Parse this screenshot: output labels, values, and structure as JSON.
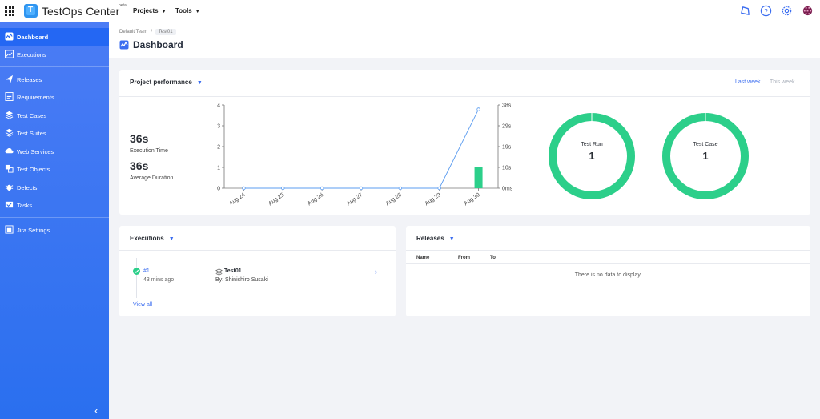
{
  "topbar": {
    "brand": "TestOps Center",
    "beta": "beta",
    "menus": [
      {
        "label": "Projects"
      },
      {
        "label": "Tools"
      }
    ],
    "icons": [
      "notification-icon",
      "help-icon",
      "settings-icon",
      "user-avatar-icon"
    ]
  },
  "sidebar": {
    "items": [
      {
        "label": "Dashboard",
        "icon": "dashboard-icon",
        "active": true
      },
      {
        "label": "Executions",
        "icon": "executions-icon"
      },
      {
        "label": "Releases",
        "icon": "releases-icon"
      },
      {
        "label": "Requirements",
        "icon": "requirements-icon"
      },
      {
        "label": "Test Cases",
        "icon": "test-cases-icon"
      },
      {
        "label": "Test Suites",
        "icon": "test-suites-icon"
      },
      {
        "label": "Web Services",
        "icon": "web-services-icon"
      },
      {
        "label": "Test Objects",
        "icon": "test-objects-icon"
      },
      {
        "label": "Defects",
        "icon": "defects-icon"
      },
      {
        "label": "Tasks",
        "icon": "tasks-icon"
      },
      {
        "label": "Jira Settings",
        "icon": "jira-icon"
      }
    ],
    "collapse_glyph": "‹"
  },
  "header": {
    "breadcrumb": [
      "Default Team",
      "Test01"
    ],
    "breadcrumb_sep": "/",
    "title": "Dashboard"
  },
  "performance": {
    "title": "Project performance",
    "tabs": {
      "last_week": "Last week",
      "this_week": "This week"
    },
    "execution_time": "36s",
    "execution_time_label": "Execution Time",
    "average_duration": "36s",
    "average_duration_label": "Average Duration",
    "donuts": [
      {
        "label": "Test Run",
        "value": "1",
        "fraction": 1.0
      },
      {
        "label": "Test Case",
        "value": "1",
        "fraction": 1.0
      }
    ]
  },
  "executions": {
    "title": "Executions",
    "items": [
      {
        "number": "#1",
        "ago": "43 mins ago",
        "name": "Test01",
        "by": "By: Shinichiro Susaki"
      }
    ],
    "view_all": "View all"
  },
  "releases": {
    "title": "Releases",
    "columns": [
      "Name",
      "From",
      "To"
    ],
    "empty": "There is no data to display."
  },
  "colors": {
    "accent": "#3b6df0",
    "success": "#2ccf8a",
    "sidebar": "#3f7af4"
  },
  "chart_data": {
    "type": "bar",
    "categories": [
      "Aug 24",
      "Aug 25",
      "Aug 26",
      "Aug 27",
      "Aug 28",
      "Aug 29",
      "Aug 30"
    ],
    "series": [
      {
        "type": "bar",
        "axis": "left",
        "values": [
          0,
          0,
          0,
          0,
          0,
          0,
          1
        ]
      },
      {
        "type": "line",
        "axis": "right",
        "values": [
          0,
          0,
          0,
          0,
          0,
          0,
          36
        ]
      }
    ],
    "y_left": {
      "ticks": [
        "0",
        "1",
        "2",
        "3",
        "4"
      ],
      "range": [
        0,
        4
      ]
    },
    "y_right": {
      "ticks": [
        "0ms",
        "10s",
        "19s",
        "29s",
        "38s"
      ],
      "range": [
        0,
        38
      ]
    },
    "grid": false
  }
}
